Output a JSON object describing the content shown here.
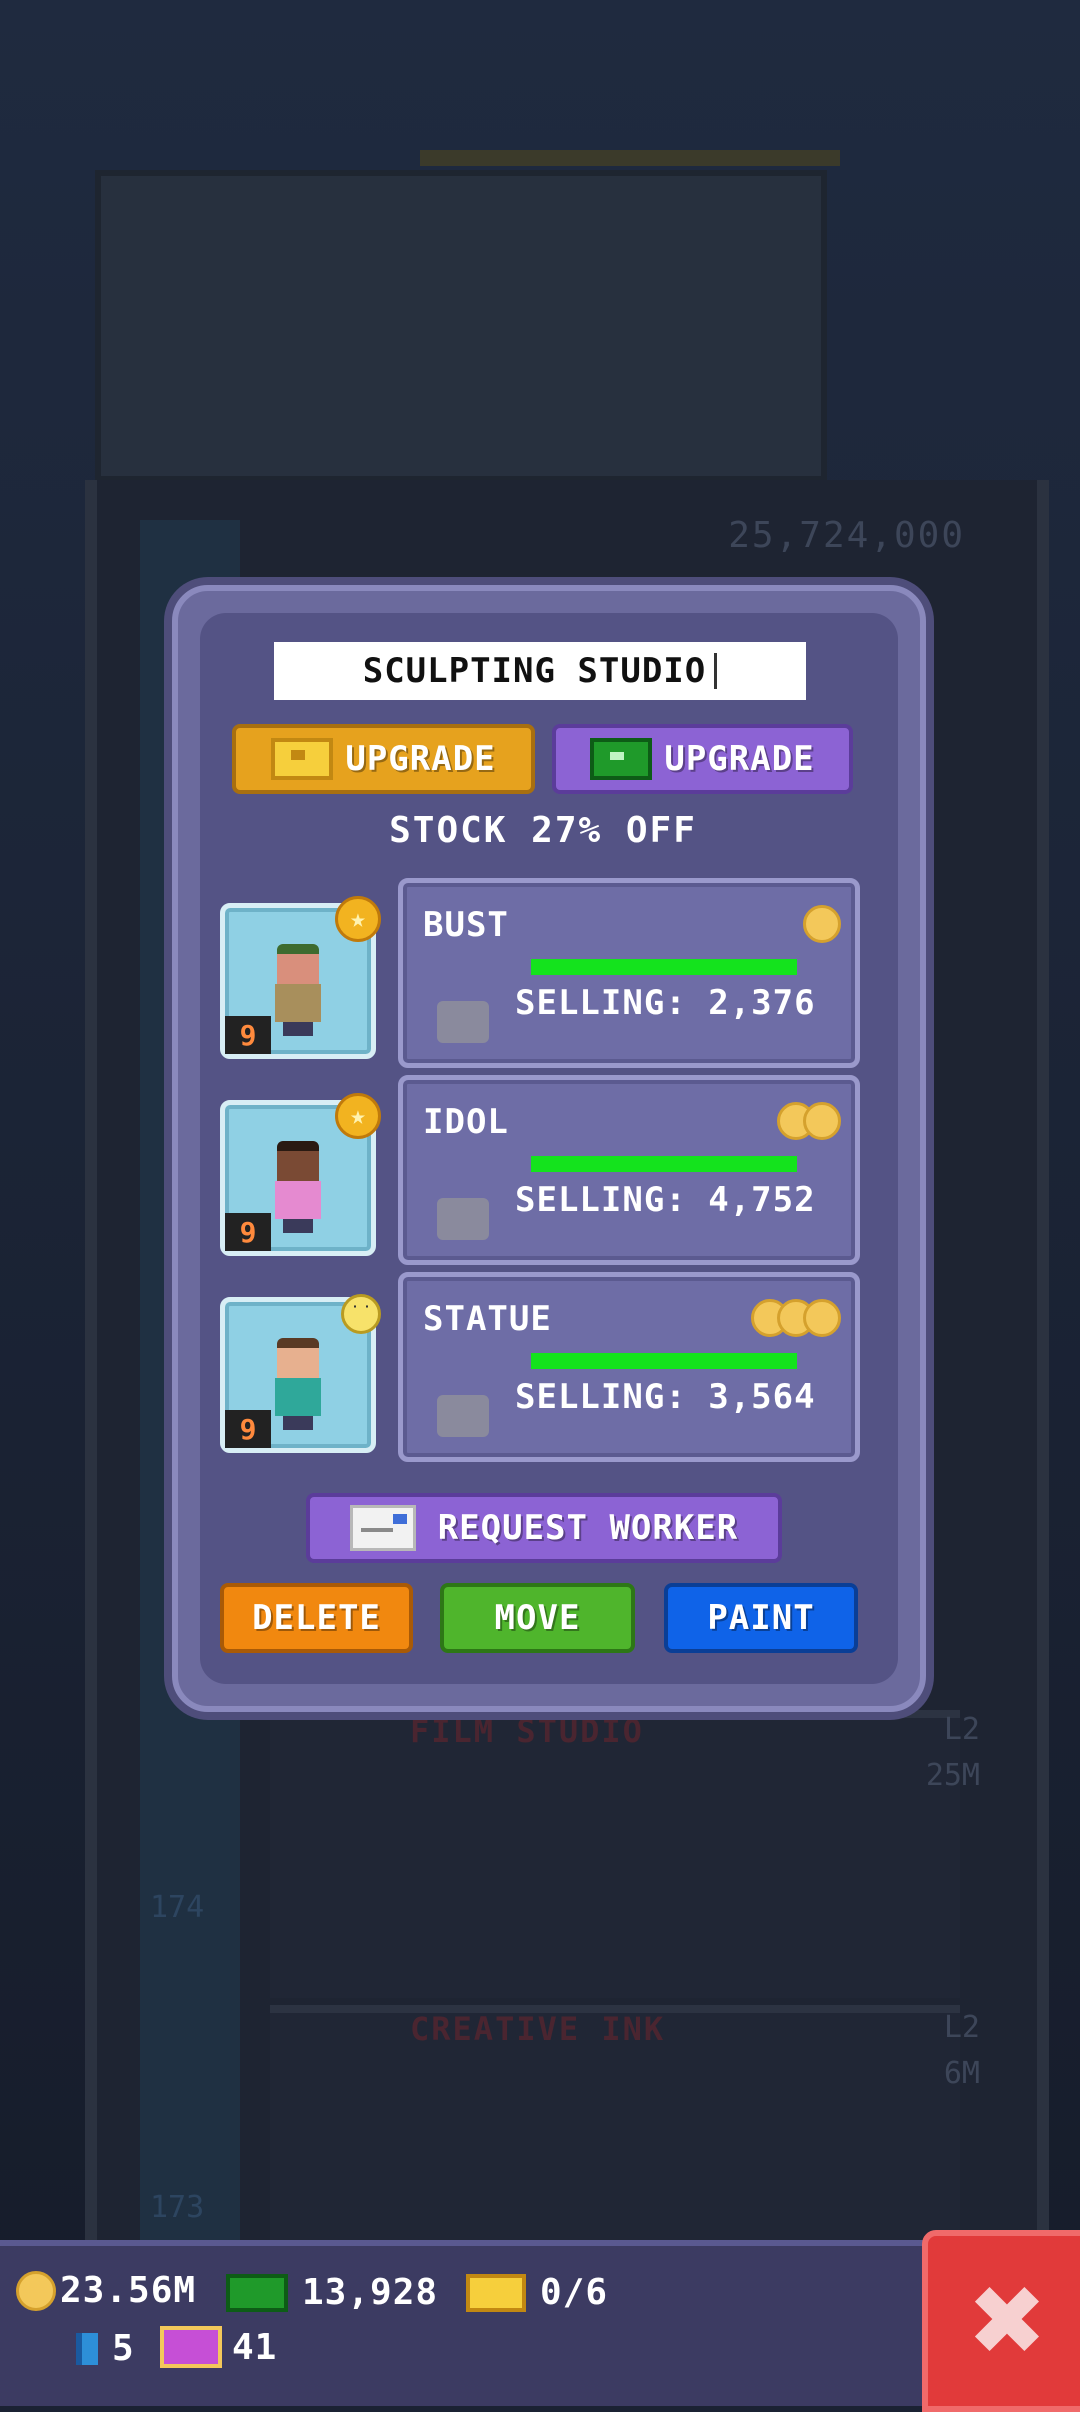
{
  "background": {
    "tower_counter": "25,724,000",
    "floors": [
      {
        "name": "FILM STUDIO",
        "level": "L2",
        "value": "25M",
        "number": "174"
      },
      {
        "name": "CREATIVE INK",
        "level": "L2",
        "value": "6M",
        "number": "173"
      }
    ]
  },
  "dialog": {
    "title": "SCULPTING STUDIO",
    "upgrade_gold_label": "UPGRADE",
    "upgrade_cash_label": "UPGRADE",
    "stock_text": "STOCK 27% OFF",
    "workers": [
      {
        "level": "9",
        "shirt": "#a88f5c",
        "skin": "#d98f7c",
        "hair": "#3e6b2f",
        "status": "star"
      },
      {
        "level": "9",
        "shirt": "#e58ad0",
        "skin": "#7a4a34",
        "hair": "#2a1a12",
        "status": "star"
      },
      {
        "level": "9",
        "shirt": "#2fa89a",
        "skin": "#e7b08f",
        "hair": "#5a3a24",
        "status": "neutral-face"
      }
    ],
    "products": [
      {
        "name": "BUST",
        "selling": "SELLING: 2,376",
        "coins": 1,
        "stock_fraction": 1.0
      },
      {
        "name": "IDOL",
        "selling": "SELLING: 4,752",
        "coins": 2,
        "stock_fraction": 1.0
      },
      {
        "name": "STATUE",
        "selling": "SELLING: 3,564",
        "coins": 3,
        "stock_fraction": 1.0
      }
    ],
    "request_worker_label": "REQUEST WORKER",
    "delete_label": "DELETE",
    "move_label": "MOVE",
    "paint_label": "PAINT"
  },
  "statusbar": {
    "coins": "23.56M",
    "bux": "13,928",
    "tickets": "0/6",
    "gems": "5",
    "vip": "41"
  },
  "colors": {
    "dialog_bg": "#545385",
    "progress": "#14e31d",
    "close": "#e13a3a"
  }
}
